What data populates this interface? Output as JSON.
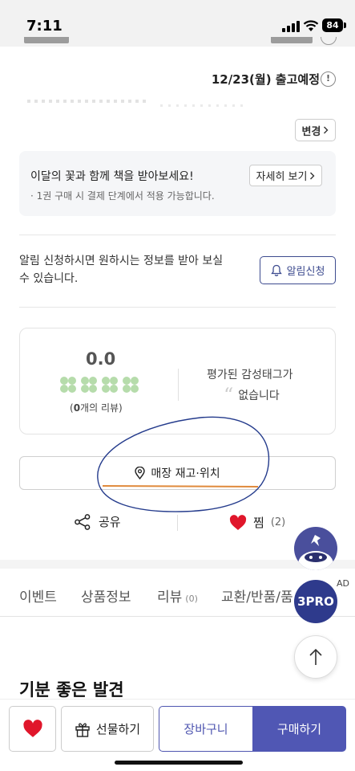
{
  "status_bar": {
    "time": "7:11",
    "battery": "84"
  },
  "delivery": {
    "date_text": "12/23(월) 출고예정",
    "change_label": "변경"
  },
  "promo": {
    "title": "이달의 꽃과 함께 책을 받아보세요!",
    "subtitle": "· 1권 구매 시 결제 단계에서 적용 가능합니다.",
    "detail_label": "자세히 보기"
  },
  "alarm": {
    "text": "알림 신청하시면 원하시는 정보를 받아 보실 수 있습니다.",
    "button_label": "알림신청"
  },
  "review": {
    "score": "0.0",
    "count_prefix": "(",
    "count_num": "0",
    "count_suffix": "개의 리뷰)",
    "rating_clovers": 0,
    "tag_line1": "평가된 감성태그가",
    "tag_line2": "없습니다"
  },
  "store": {
    "label": "매장 재고·위치"
  },
  "actions": {
    "share_label": "공유",
    "like_label": "찜",
    "like_count": "(2)"
  },
  "tabs": [
    {
      "label": "이벤트"
    },
    {
      "label": "상품정보"
    },
    {
      "label": "리뷰",
      "sub": "(0)"
    },
    {
      "label": "교환/반품/품"
    }
  ],
  "floating": {
    "pro_label": "3PRO",
    "ad_label": "AD"
  },
  "headline": "기분 좋은 발견",
  "bottom": {
    "gift_label": "선물하기",
    "cart_label": "장바구니",
    "buy_label": "구매하기"
  },
  "colors": {
    "accent": "#5057b4",
    "alarm_border": "#3d4b8f",
    "heart": "#e0162b",
    "clover": "#b6dcab"
  }
}
